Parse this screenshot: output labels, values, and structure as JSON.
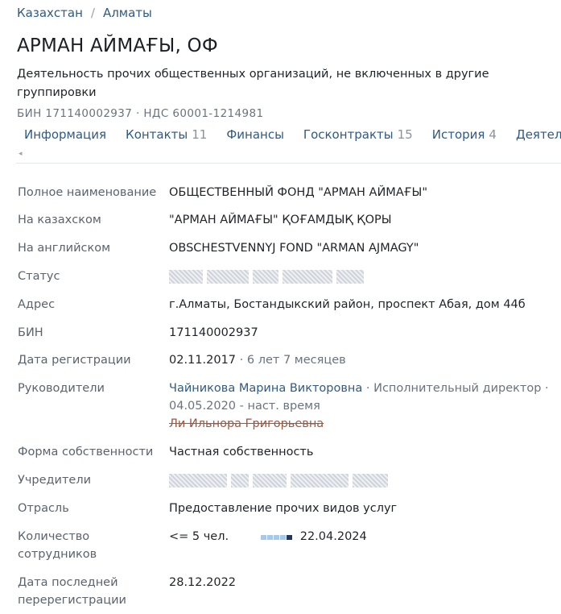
{
  "breadcrumb": {
    "country": "Казахстан",
    "separator": "/",
    "city": "Алматы"
  },
  "company": {
    "title": "АРМАН АЙМАҒЫ, ОФ",
    "activity": "Деятельность прочих общественных организаций, не включенных в другие группировки",
    "ids": "БИН 171140002937 · НДС 60001-1214981"
  },
  "tabs": [
    {
      "label": "Информация",
      "count": ""
    },
    {
      "label": "Контакты",
      "count": "11"
    },
    {
      "label": "Финансы",
      "count": ""
    },
    {
      "label": "Госконтракты",
      "count": "15"
    },
    {
      "label": "История",
      "count": "4"
    },
    {
      "label": "Деятельность",
      "count": ""
    }
  ],
  "scroll_arrow": "◂",
  "fields": {
    "full_name": {
      "label": "Полное наименование",
      "value": "ОБЩЕСТВЕННЫЙ ФОНД \"АРМАН АЙМАҒЫ\""
    },
    "kazakh": {
      "label": "На казахском",
      "value": "\"АРМАН АЙМАҒЫ\" ҚОҒАМДЫҚ ҚОРЫ"
    },
    "english": {
      "label": "На английском",
      "value": "OBSCHESTVENNYJ FOND \"ARMAN AJMAGY\""
    },
    "status": {
      "label": "Статус"
    },
    "address": {
      "label": "Адрес",
      "value": "г.Алматы, Бостандыкский район, проспект Абая, дом 44б"
    },
    "bin": {
      "label": "БИН",
      "value": "171140002937"
    },
    "reg_date": {
      "label": "Дата регистрации",
      "value": "02.11.2017",
      "age": "· 6 лет 7 месяцев"
    },
    "heads": {
      "label": "Руководители",
      "current_name": "Чайникова Марина Викторовна",
      "current_role": "· Исполнительный директор · 04.05.2020 - наст. время",
      "former_name": "Ли Ильнора Григорьевна"
    },
    "ownership": {
      "label": "Форма собственности",
      "value": "Частная собственность"
    },
    "founders": {
      "label": "Учредители"
    },
    "industry": {
      "label": "Отрасль",
      "value": "Предоставление прочих видов услуг"
    },
    "employees": {
      "label": "Количество сотрудников",
      "value": "<= 5 чел.",
      "date": "22.04.2024"
    },
    "last_rereg": {
      "label": "Дата последней перерегистрации",
      "value": "28.12.2022"
    }
  }
}
